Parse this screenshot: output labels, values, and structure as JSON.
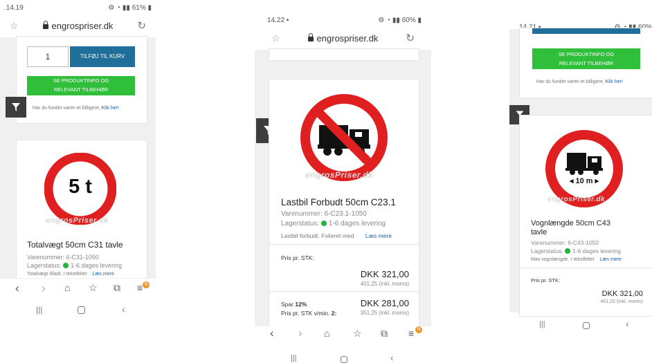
{
  "screens": [
    {
      "status_time": ".14.19",
      "status_right": "61%",
      "url": "engrospriser.dk",
      "qty_value": "1",
      "add_to_cart": "TILFØJ TIL KURV",
      "product_info_btn": "SE PRODUKTINFO OG RELEVANT TILBEHØR",
      "cheaper_text": "Har du fundet varen et billigere,",
      "cheaper_link": "Klik her!",
      "sign_text": "5 t",
      "watermark": "engrosPriser.dk",
      "product_title": "Totalvægt 50cm C31 tavle",
      "sku": "Varenummer: 6-C31-1050",
      "stock_label": "Lagerstatus:",
      "stock_value": "1-6 dages levering",
      "desc": "Totalvægt tilladt. I tekstfeltet",
      "read_more": "Læs mere",
      "badge": "N"
    },
    {
      "status_time": "14.22",
      "status_right": "60%",
      "url": "engrospriser.dk",
      "watermark": "engrosPriser.dk",
      "product_title": "Lastbil Forbudt 50cm C23.1",
      "sku": "Varenummer: 6-C23.1-1050",
      "stock_label": "Lagerstatus:",
      "stock_value": "1-6 dages levering",
      "desc": "Lastbil forbudt. Folieret med",
      "read_more": "Læs mere",
      "price_label": "Pris pr. STK:",
      "price": "DKK 321,00",
      "price_incl": "401,25 (inkl. moms)",
      "save_label": "Spar",
      "save_pct": "12%",
      "bulk_label": "Pris pr. STK v/min.",
      "bulk_min": "2:",
      "bulk_price": "DKK 281,00",
      "bulk_incl": "351,25 (inkl. moms)",
      "badge": "N"
    },
    {
      "status_time": "14.21",
      "status_right": "60%",
      "product_info_btn": "SE PRODUKTINFO OG RELEVANT TILBEHØR",
      "cheaper_text": "Har du fundet varen et billigere,",
      "cheaper_link": "Klik her!",
      "sign_text": "◂ 10 m ▸",
      "watermark": "engrosPriser.dk",
      "product_title_1": "Vognlængde 50cm C43",
      "product_title_2": "tavle",
      "sku": "Varenummer: 6-C43-1050",
      "stock_label": "Lagerstatus:",
      "stock_value": "1-6 dages levering",
      "desc": "Max vognlængde. I tekstfeltet",
      "read_more": "Læs mere",
      "price_label": "Pris pr. STK:",
      "price": "DKK 321,00",
      "price_incl": "401,25 (inkl. moms)"
    }
  ],
  "icons": {
    "filter": "filter-icon",
    "back": "back-icon",
    "forward": "forward-icon",
    "home": "home-icon",
    "bookmarks": "bookmark-star-icon",
    "tabs": "tabs-icon",
    "menu": "menu-icon"
  },
  "colors": {
    "blue": "#1f6f9a",
    "green": "#2fbf3a",
    "red": "#e02020",
    "link": "#1a5fa8"
  }
}
